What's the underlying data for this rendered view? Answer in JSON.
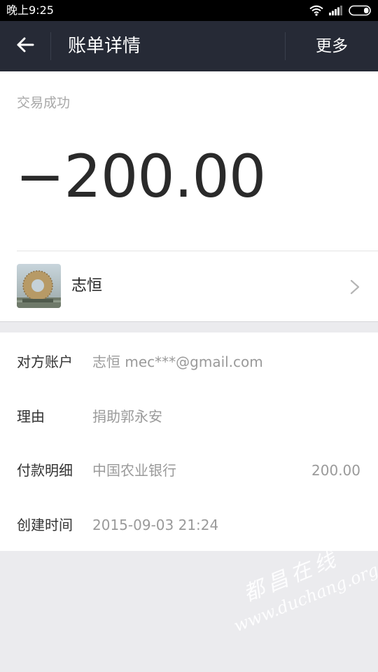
{
  "status_bar": {
    "time": "晚上9:25",
    "icons": [
      "wifi-icon",
      "signal-icon",
      "battery-icon"
    ]
  },
  "nav": {
    "back_icon": "arrow-left-icon",
    "title": "账单详情",
    "more_label": "更多"
  },
  "summary": {
    "status": "交易成功",
    "amount": "−200.00",
    "payee_name": "志恒",
    "chevron_icon": "chevron-right-icon"
  },
  "details": {
    "counterparty_label": "对方账户",
    "counterparty_value": "志恒 mec***@gmail.com",
    "reason_label": "理由",
    "reason_value": "捐助郭永安",
    "payment_label": "付款明细",
    "payment_bank": "中国农业银行",
    "payment_amount": "200.00",
    "created_label": "创建时间",
    "created_value": "2015-09-03 21:24"
  },
  "watermark": {
    "cn": "都昌在线",
    "url": "www.duchang.org"
  },
  "colors": {
    "nav_background": "#262a36",
    "status_background": "#000000",
    "page_background": "#ebebee",
    "amount_text": "#2a2a2a",
    "muted_text": "#9a9a9a"
  }
}
